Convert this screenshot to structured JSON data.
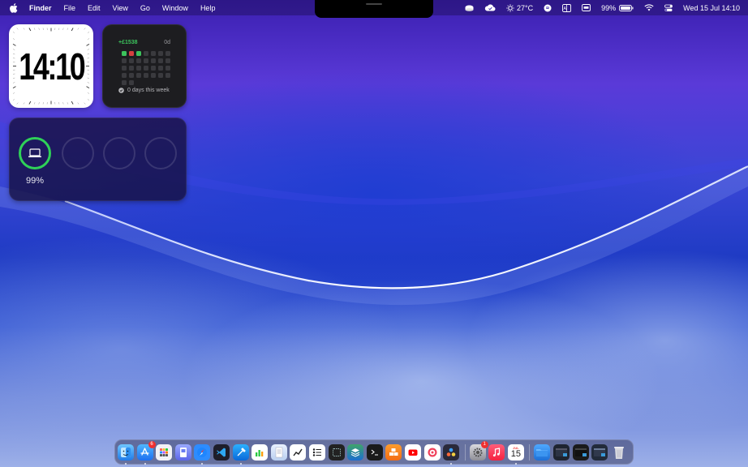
{
  "menubar": {
    "app_name": "Finder",
    "menus": [
      "File",
      "Edit",
      "View",
      "Go",
      "Window",
      "Help"
    ],
    "weather": "27°C",
    "battery": "99%",
    "datetime": "Wed 15 Jul  14:10"
  },
  "widgets": {
    "clock": {
      "time": "14:10"
    },
    "habit": {
      "score": "+£1538",
      "days": "0d",
      "footer": "0 days this week"
    },
    "battery": {
      "percent": "99%",
      "level": 0.99
    }
  },
  "dock": {
    "calendar": {
      "month": "JUL",
      "day": "15"
    },
    "badges": {
      "app_store": "6",
      "system_settings": "1"
    }
  },
  "colors": {
    "battery_ring": "#2fd158",
    "habit_green": "#3cc35c",
    "habit_red": "#d64040",
    "badge": "#f0302f"
  }
}
